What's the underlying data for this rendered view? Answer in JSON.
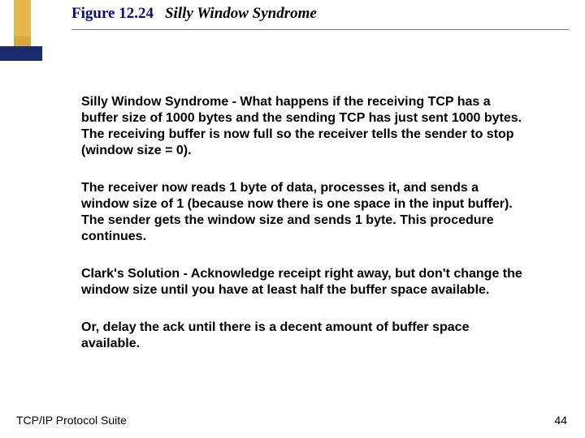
{
  "header": {
    "figure_label": "Figure 12.24",
    "figure_title": "Silly Window Syndrome"
  },
  "paragraphs": {
    "p1": "Silly Window Syndrome - What happens if the receiving TCP has a buffer size of 1000 bytes and the sending TCP has just sent 1000 bytes.  The receiving buffer is now full so the receiver tells the sender to stop (window size = 0).",
    "p2": "The receiver now reads 1 byte of data, processes it, and sends a window size of 1 (because now there is one space in the input buffer).  The sender gets the window size and sends 1 byte.  This procedure continues.",
    "p3": "Clark's Solution - Acknowledge receipt right away, but don't change the window size until you have at least half the buffer space available.",
    "p4": "Or, delay the ack until there is a decent amount of buffer space available."
  },
  "footer": {
    "left": "TCP/IP Protocol Suite",
    "page_number": "44"
  }
}
